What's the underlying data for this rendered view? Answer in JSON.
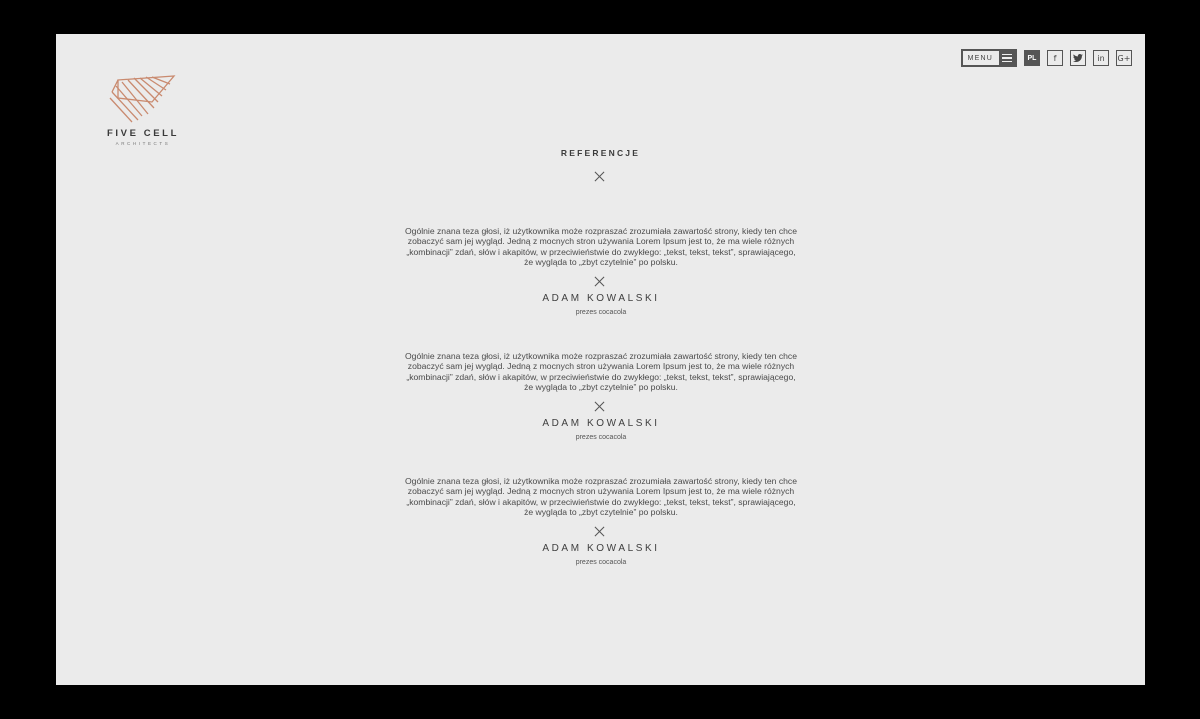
{
  "logo": {
    "name": "FIVE CELL",
    "sub": "ARCHITECTS",
    "accent_color": "#c98a6f"
  },
  "topbar": {
    "menu_label": "MENU",
    "lang_label": "PL",
    "social": [
      {
        "icon": "facebook-icon",
        "glyph": "f"
      },
      {
        "icon": "twitter-icon",
        "glyph": ""
      },
      {
        "icon": "linkedin-icon",
        "glyph": "in"
      },
      {
        "icon": "google-plus-icon",
        "glyph": "G+"
      }
    ]
  },
  "section": {
    "title": "REFERENCJE"
  },
  "testimonials": [
    {
      "quote": "Ogólnie znana teza głosi, iż użytkownika może rozpraszać zrozumiała zawartość strony, kiedy ten chce zobaczyć sam jej wygląd. Jedną z mocnych stron używania Lorem Ipsum jest to, że ma wiele różnych „kombinacji” zdań, słów i akapitów, w przeciwieństwie do zwykłego: „tekst, tekst, tekst”, sprawiającego, że wygląda to „zbyt czytelnie” po polsku.",
      "name": "ADAM KOWALSKI",
      "role": "prezes cocacola"
    },
    {
      "quote": "Ogólnie znana teza głosi, iż użytkownika może rozpraszać zrozumiała zawartość strony, kiedy ten chce zobaczyć sam jej wygląd. Jedną z mocnych stron używania Lorem Ipsum jest to, że ma wiele różnych „kombinacji” zdań, słów i akapitów, w przeciwieństwie do zwykłego: „tekst, tekst, tekst”, sprawiającego, że wygląda to „zbyt czytelnie” po polsku.",
      "name": "ADAM KOWALSKI",
      "role": "prezes cocacola"
    },
    {
      "quote": "Ogólnie znana teza głosi, iż użytkownika może rozpraszać zrozumiała zawartość strony, kiedy ten chce zobaczyć sam jej wygląd. Jedną z mocnych stron używania Lorem Ipsum jest to, że ma wiele różnych „kombinacji” zdań, słów i akapitów, w przeciwieństwie do zwykłego: „tekst, tekst, tekst”, sprawiającego, że wygląda to „zbyt czytelnie” po polsku.",
      "name": "ADAM KOWALSKI",
      "role": "prezes cocacola"
    }
  ]
}
